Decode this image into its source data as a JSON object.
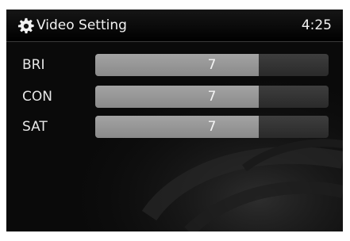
{
  "header": {
    "title": "Video Setting",
    "time": "4:25",
    "icon": "gear-icon"
  },
  "settings": [
    {
      "label": "BRI",
      "value": "7",
      "level": 0.7
    },
    {
      "label": "CON",
      "value": "7",
      "level": 0.7
    },
    {
      "label": "SAT",
      "value": "7",
      "level": 0.7
    }
  ],
  "colors": {
    "background": "#0a0a0a",
    "slider_track": "#333333",
    "slider_fill": "#999999",
    "text": "#f2f2f2"
  }
}
